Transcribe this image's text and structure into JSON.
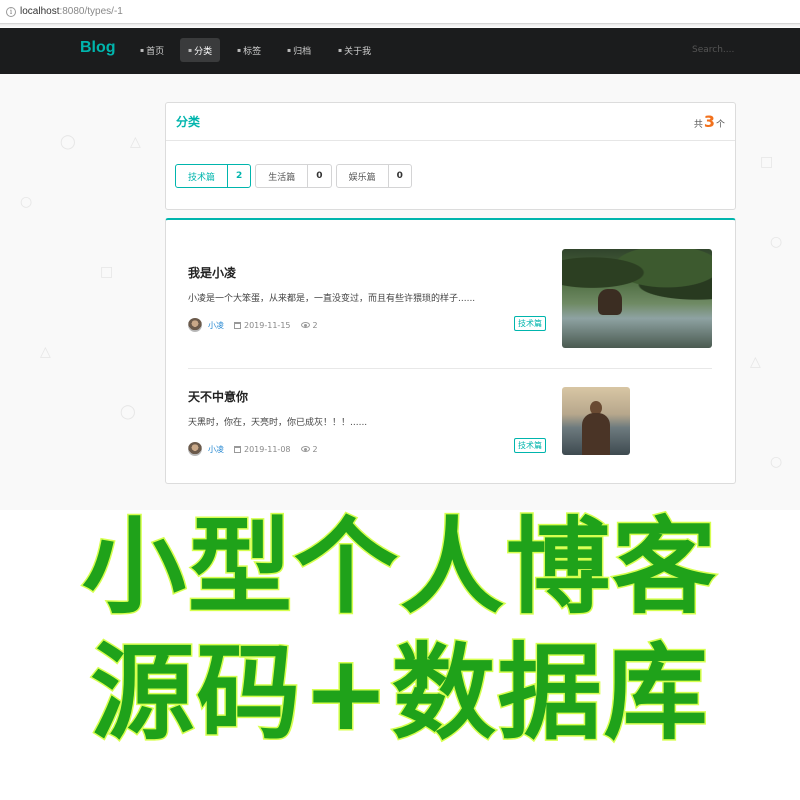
{
  "browser": {
    "url_host": "localhost",
    "url_rest": ":8080/types/-1"
  },
  "nav": {
    "brand": "Blog",
    "items": [
      {
        "label": "首页",
        "icon": "home-icon",
        "active": false
      },
      {
        "label": "分类",
        "icon": "idea-icon",
        "active": true
      },
      {
        "label": "标签",
        "icon": "tags-icon",
        "active": false
      },
      {
        "label": "归档",
        "icon": "clone-icon",
        "active": false
      },
      {
        "label": "关于我",
        "icon": "info-icon",
        "active": false
      }
    ],
    "search_placeholder": "Search...."
  },
  "types": {
    "title": "分类",
    "count_prefix": "共",
    "count": "3",
    "count_suffix": "个",
    "list": [
      {
        "name": "技术篇",
        "count": "2",
        "active": true
      },
      {
        "name": "生活篇",
        "count": "0",
        "active": false
      },
      {
        "name": "娱乐篇",
        "count": "0",
        "active": false
      }
    ]
  },
  "posts": [
    {
      "title": "我是小凌",
      "excerpt": "小凌是一个大笨蛋，从来都是，一直没变过，而且有些许猥琐的样子......",
      "author": "小凌",
      "date": "2019-11-15",
      "views": "2",
      "tag": "技术篇"
    },
    {
      "title": "天不中意你",
      "excerpt": "天黑时，你在，天亮时，你已成灰！！！......",
      "author": "小凌",
      "date": "2019-11-08",
      "views": "2",
      "tag": "技术篇"
    }
  ],
  "promo": {
    "line1": "小型个人博客",
    "line2": "源码+数据库"
  },
  "colors": {
    "accent": "#00b5ad",
    "nav_bg": "#1b1c1d",
    "count_orange": "#f2711c",
    "promo_green": "#1fa21a",
    "promo_outline": "#d6ff4f"
  }
}
